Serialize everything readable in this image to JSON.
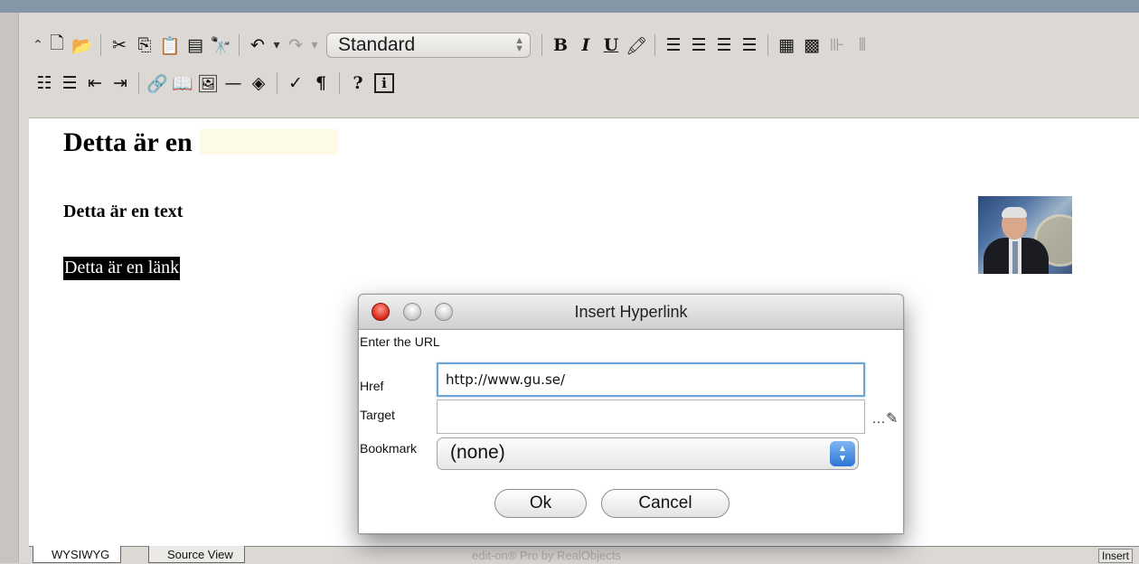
{
  "toolbar_row1": {
    "style_select_value": "Standard",
    "icons": [
      "collapse-icon",
      "new-document-icon",
      "open-folder-icon",
      "cut-icon",
      "copy-icon",
      "paste-icon",
      "paste-text-icon",
      "find-icon",
      "undo-icon",
      "dropdown-icon",
      "redo-icon",
      "dropdown-icon",
      "bold-icon",
      "italic-icon",
      "underline-icon",
      "highlight-icon",
      "align-left-icon",
      "align-center-icon",
      "align-right-icon",
      "align-justify-icon",
      "table-icon",
      "insert-table-icon",
      "table-row-icon",
      "table-column-icon"
    ],
    "bold_label": "B",
    "italic_label": "I",
    "underline_label": "U"
  },
  "toolbar_row2": {
    "icons": [
      "bulleted-list-icon",
      "numbered-list-icon",
      "outdent-icon",
      "indent-icon",
      "link-icon",
      "bookmark-icon",
      "image-icon",
      "horizontal-rule-icon",
      "object-icon",
      "spellcheck-icon",
      "pilcrow-icon",
      "help-icon",
      "info-icon"
    ],
    "help_label": "?",
    "info_label": "i",
    "pilcrow_label": "¶"
  },
  "editor": {
    "heading1": "Detta är en",
    "heading4": "Detta är en text",
    "link_text": "Detta är en länk"
  },
  "tabs": {
    "wysiwyg": "WYSIWYG",
    "source": "Source View",
    "credits": "edit-on® Pro by RealObjects",
    "mode": "Insert"
  },
  "dialog": {
    "title": "Insert Hyperlink",
    "prompt": "Enter the URL",
    "href_label": "Href",
    "href_value": "http://www.gu.se/",
    "target_label": "Target",
    "target_value": "",
    "bookmark_label": "Bookmark",
    "bookmark_value": "(none)",
    "ok_label": "Ok",
    "cancel_label": "Cancel"
  },
  "colors": {
    "titlebar_blue": "#8596a6",
    "focus_ring": "#6fa2d6",
    "close_red": "#d9241a",
    "select_arrow_blue": "#2b75d6"
  }
}
